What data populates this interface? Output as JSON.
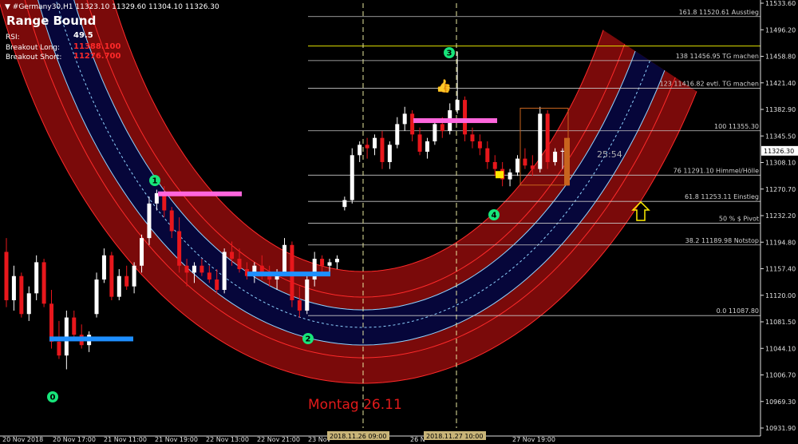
{
  "header": {
    "symbol_line": "#Germany30,H1  11323.10 11329.60 11304.10 11326.30",
    "menu_icon": "triangle-down-icon"
  },
  "panel": {
    "title": "Range Bound",
    "rsi_label": "RSI:",
    "rsi_value": "49.5",
    "breakout_long_label": "Breakout Long:",
    "breakout_long_value": "11388.100",
    "breakout_short_label": "Breakout Short:",
    "breakout_short_value": "11276.700"
  },
  "annotations": {
    "montag": "Montag 26.11",
    "countdown": "25:54",
    "markers": [
      "0",
      "1",
      "2",
      "3",
      "4"
    ]
  },
  "colors": {
    "background": "#000000",
    "bull_candle": "#ffffff",
    "bear_candle": "#e8171c",
    "channel_fill": "#7a0a0a",
    "channel_core": "#06063a",
    "channel_edge": "#ff2a2a",
    "channel_inner": "#8fd3ff",
    "fib_line": "#c8c8c8",
    "marker_fill": "#17e57a",
    "support_bar": "#1e8fff",
    "resistance_bar": "#ff66dd",
    "arrow": "#ffee00"
  },
  "chart_data": {
    "type": "candlestick",
    "symbol": "#Germany30",
    "timeframe": "H1",
    "ylim": [
      10925,
      11540
    ],
    "price_ticks": [
      "11533.60",
      "11496.20",
      "11458.80",
      "11421.40",
      "11382.90",
      "11345.50",
      "11308.10",
      "11270.70",
      "11232.20",
      "11194.80",
      "11157.40",
      "11120.00",
      "11081.50",
      "11044.10",
      "11006.70",
      "10969.30",
      "10931.90"
    ],
    "current_price": "11326.30",
    "time_ticks": [
      "20 Nov 2018",
      "20 Nov 17:00",
      "21 Nov 11:00",
      "21 Nov 19:00",
      "22 Nov 13:00",
      "22 Nov 21:00",
      "23 Nov",
      "26 N",
      "27 Nov 19:00"
    ],
    "time_markers": [
      "2018.11.26 09:00",
      "2018.11.27 10:00"
    ],
    "fib_levels": [
      {
        "ratio": "161.8",
        "price": 11520.61,
        "label": "161.8 11520.61  Ausstieg"
      },
      {
        "ratio": "138",
        "price": 11456.95,
        "label": "138 11456.95  TG machen"
      },
      {
        "ratio": "123",
        "price": 11416.82,
        "label": "123 11416.82  evtl. TG machen"
      },
      {
        "ratio": "100",
        "price": 11355.3,
        "label": "100 11355.30"
      },
      {
        "ratio": "76",
        "price": 11291.1,
        "label": "76 11291.10  Himmel/Hölle"
      },
      {
        "ratio": "61.8",
        "price": 11253.11,
        "label": "61.8 11253.11  Einstieg"
      },
      {
        "ratio": "50",
        "price": 11221.45,
        "label": "50 %  $ Pivot"
      },
      {
        "ratio": "38.2",
        "price": 11189.98,
        "label": "38.2 11189.98  Notstop"
      },
      {
        "ratio": "0.0",
        "price": 11087.8,
        "label": "0.0 11087.80"
      }
    ],
    "breakout_long": 11388.1,
    "breakout_short": 11276.7,
    "ohlc": [
      [
        11180,
        11200,
        11100,
        11110
      ],
      [
        11110,
        11160,
        11095,
        11145
      ],
      [
        11145,
        11150,
        11085,
        11090
      ],
      [
        11090,
        11130,
        11080,
        11120
      ],
      [
        11120,
        11175,
        11110,
        11165
      ],
      [
        11165,
        11170,
        11100,
        11105
      ],
      [
        11105,
        11125,
        11040,
        11050
      ],
      [
        11050,
        11080,
        11025,
        11030
      ],
      [
        11030,
        11095,
        11010,
        11085
      ],
      [
        11085,
        11095,
        11055,
        11060
      ],
      [
        11060,
        11075,
        11040,
        11045
      ],
      [
        11045,
        11065,
        11035,
        11060
      ],
      [
        11090,
        11150,
        11085,
        11140
      ],
      [
        11140,
        11185,
        11135,
        11175
      ],
      [
        11175,
        11180,
        11110,
        11115
      ],
      [
        11115,
        11155,
        11110,
        11145
      ],
      [
        11145,
        11160,
        11125,
        11130
      ],
      [
        11130,
        11165,
        11120,
        11160
      ],
      [
        11160,
        11205,
        11150,
        11200
      ],
      [
        11200,
        11260,
        11190,
        11250
      ],
      [
        11250,
        11270,
        11240,
        11265
      ],
      [
        11265,
        11275,
        11230,
        11240
      ],
      [
        11240,
        11245,
        11200,
        11210
      ],
      [
        11210,
        11230,
        11150,
        11160
      ],
      [
        11160,
        11170,
        11130,
        11150
      ],
      [
        11150,
        11165,
        11135,
        11160
      ],
      [
        11160,
        11170,
        11145,
        11150
      ],
      [
        11150,
        11160,
        11135,
        11140
      ],
      [
        11140,
        11155,
        11120,
        11125
      ],
      [
        11125,
        11185,
        11120,
        11180
      ],
      [
        11180,
        11195,
        11160,
        11170
      ],
      [
        11170,
        11185,
        11150,
        11155
      ],
      [
        11155,
        11165,
        11140,
        11145
      ],
      [
        11145,
        11165,
        11135,
        11160
      ],
      [
        11160,
        11175,
        11140,
        11145
      ],
      [
        11145,
        11160,
        11130,
        11140
      ],
      [
        11140,
        11155,
        11125,
        11150
      ],
      [
        11150,
        11200,
        11145,
        11190
      ],
      [
        11190,
        11195,
        11100,
        11110
      ],
      [
        11110,
        11130,
        11085,
        11095
      ],
      [
        11095,
        11150,
        11090,
        11140
      ],
      [
        11140,
        11180,
        11130,
        11170
      ],
      [
        11170,
        11175,
        11150,
        11160
      ],
      [
        11160,
        11170,
        11150,
        11165
      ],
      [
        11165,
        11175,
        11155,
        11170
      ],
      [
        11245,
        11260,
        11240,
        11255
      ],
      [
        11255,
        11330,
        11250,
        11320
      ],
      [
        11320,
        11340,
        11310,
        11335
      ],
      [
        11335,
        11345,
        11315,
        11330
      ],
      [
        11330,
        11350,
        11320,
        11345
      ],
      [
        11345,
        11355,
        11300,
        11310
      ],
      [
        11310,
        11340,
        11300,
        11335
      ],
      [
        11335,
        11375,
        11330,
        11365
      ],
      [
        11365,
        11390,
        11355,
        11380
      ],
      [
        11380,
        11385,
        11340,
        11350
      ],
      [
        11350,
        11360,
        11320,
        11325
      ],
      [
        11325,
        11345,
        11315,
        11340
      ],
      [
        11340,
        11370,
        11335,
        11365
      ],
      [
        11365,
        11375,
        11345,
        11355
      ],
      [
        11355,
        11395,
        11350,
        11385
      ],
      [
        11385,
        11470,
        11380,
        11400
      ],
      [
        11400,
        11405,
        11340,
        11350
      ],
      [
        11350,
        11360,
        11330,
        11340
      ],
      [
        11340,
        11350,
        11320,
        11330
      ],
      [
        11330,
        11340,
        11300,
        11310
      ],
      [
        11310,
        11320,
        11290,
        11300
      ],
      [
        11300,
        11310,
        11275,
        11285
      ],
      [
        11285,
        11300,
        11275,
        11295
      ],
      [
        11295,
        11320,
        11290,
        11315
      ],
      [
        11315,
        11330,
        11300,
        11305
      ],
      [
        11305,
        11320,
        11290,
        11300
      ],
      [
        11300,
        11390,
        11295,
        11380
      ],
      [
        11380,
        11385,
        11300,
        11310
      ],
      [
        11310,
        11330,
        11305,
        11325
      ],
      [
        11325,
        11330,
        11300,
        11326.3
      ]
    ]
  }
}
